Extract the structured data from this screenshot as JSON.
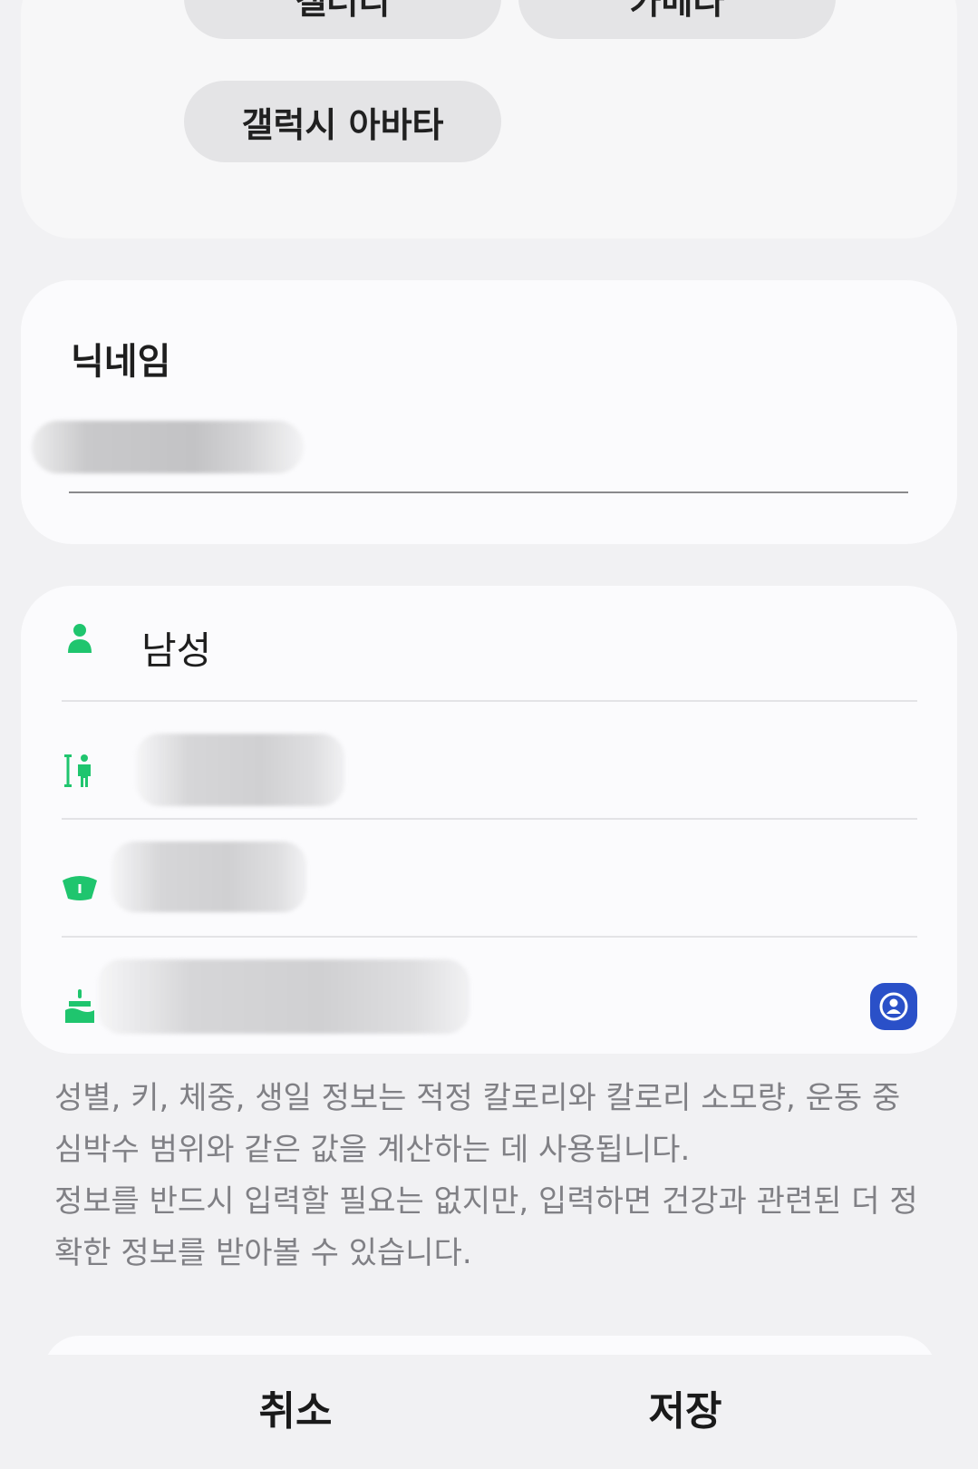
{
  "photo_sources": {
    "gallery_label": "갤러리",
    "camera_label": "카메라",
    "avatar_label": "갤럭시 아바타"
  },
  "nickname": {
    "label": "닉네임",
    "value": ""
  },
  "body_info": {
    "gender": {
      "icon": "person-icon",
      "value": "남성"
    },
    "height": {
      "icon": "height-icon",
      "value": ""
    },
    "weight": {
      "icon": "scale-icon",
      "value": ""
    },
    "birthday": {
      "icon": "cake-icon",
      "value": ""
    },
    "account_icon": "account-icon"
  },
  "description": {
    "line1": "성별, 키, 체중, 생일 정보는 적정 칼로리와 칼로리 소모량, 운동 중 심박수 범위와 같은 값을 계산하는 데 사용됩니다.",
    "line2": "정보를 반드시 입력할 필요는 없지만, 입력하면 건강과 관련된 더 정확한 정보를 받아볼 수 있습니다."
  },
  "actions": {
    "cancel_label": "취소",
    "save_label": "저장"
  },
  "colors": {
    "accent_green": "#1fc56e",
    "account_blue": "#2a50c8",
    "background": "#f1f1f3",
    "card": "#fbfbfd"
  }
}
